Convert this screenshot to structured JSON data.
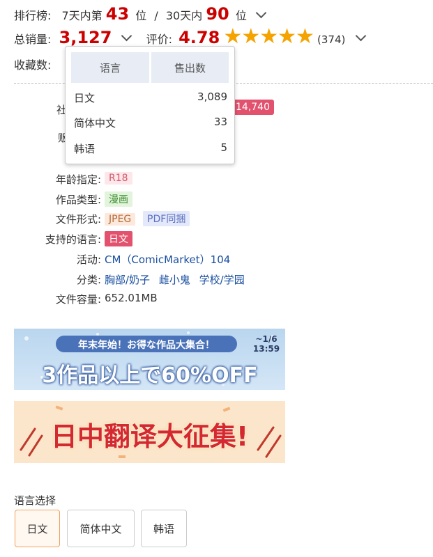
{
  "ranking": {
    "label": "排行榜:",
    "seven_day_prefix": "7天内第",
    "seven_day_rank": "43",
    "unit": "位",
    "separator": "/",
    "thirty_day_prefix": "30天内",
    "thirty_day_rank": "90"
  },
  "sales": {
    "label": "总销量:",
    "value": "3,127",
    "rating_label": "评价:",
    "rating_value": "4.78",
    "stars": "★★★★★",
    "rating_count": "(374)"
  },
  "favorites": {
    "label": "收藏数:"
  },
  "popup": {
    "col_language": "语言",
    "col_sold": "售出数",
    "rows": [
      {
        "lang": "日文",
        "sold": "3,089"
      },
      {
        "lang": "简体中文",
        "sold": "33"
      },
      {
        "lang": "韩语",
        "sold": "5"
      }
    ]
  },
  "hidden_count": "14,740",
  "partial_labels": {
    "a": "社",
    "b": "贩"
  },
  "details": {
    "age_label": "年龄指定",
    "age_value": "R18",
    "type_label": "作品类型",
    "type_value": "漫画",
    "format_label": "文件形式",
    "format_values": [
      "JPEG",
      "PDF同捆"
    ],
    "lang_label": "支持的语言",
    "lang_value": "日文",
    "event_label": "活动",
    "event_value": "CM（ComicMarket）104",
    "genre_label": "分类",
    "genres": [
      "胸部/奶子",
      "雌小鬼",
      "学校/学园"
    ],
    "size_label": "文件容量",
    "size_value": "652.01MB",
    "colon": ":"
  },
  "banner1": {
    "top_text": "年末年始！お得な作品大集合！",
    "main_text": "3作品以上で60%OFF",
    "date_text": "~1/6",
    "time_text": "13:59"
  },
  "banner2": {
    "text": "日中翻译大征集!"
  },
  "language_select": {
    "label": "语言选择",
    "options": [
      "日文",
      "简体中文",
      "韩语"
    ]
  },
  "colors": {
    "accent_red": "#cc0000",
    "star": "#f4a300",
    "pink_tag": "#e2526f",
    "link": "#1a4fa0"
  }
}
